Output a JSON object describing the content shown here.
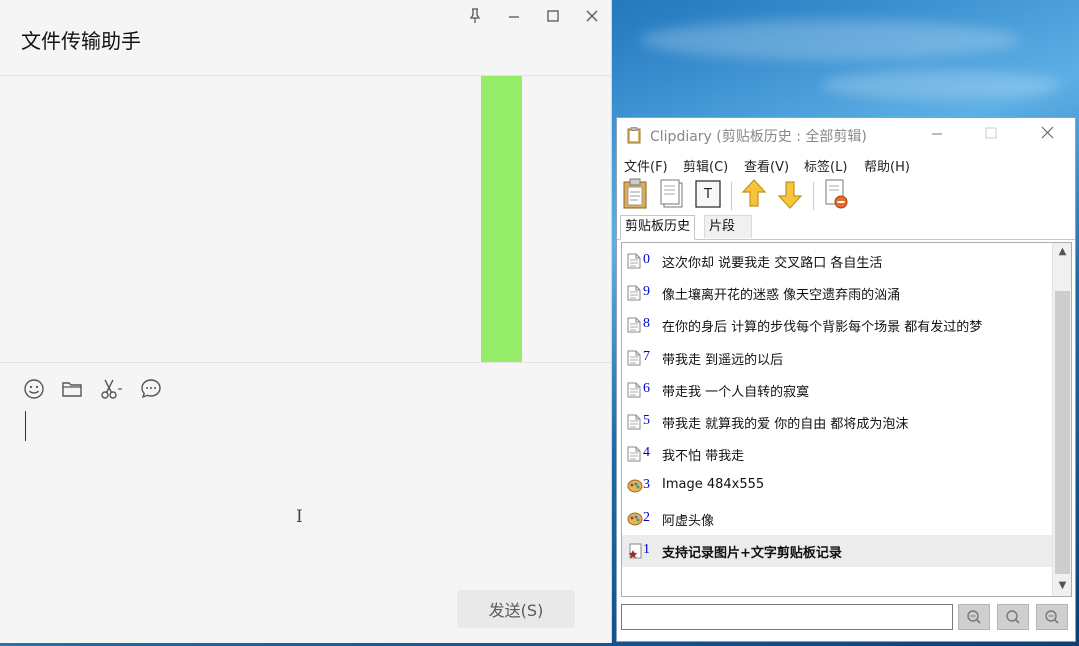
{
  "wechat": {
    "title": "文件传输助手",
    "send_label": "发送(S)",
    "window_controls": [
      "pin-icon",
      "minimize-icon",
      "maximize-icon",
      "close-icon"
    ],
    "toolbar_icons": [
      "emoji-icon",
      "folder-icon",
      "scissors-icon",
      "chat-history-icon"
    ],
    "bubble_color": "#95ec69"
  },
  "clipdiary": {
    "title": "Clipdiary (剪贴板历史 : 全部剪辑)",
    "menu": [
      "文件(F)",
      "剪辑(C)",
      "查看(V)",
      "标签(L)",
      "帮助(H)"
    ],
    "toolbar_icons": [
      "paste-icon",
      "copy-icon",
      "text-icon",
      "move-up-icon",
      "move-down-icon",
      "delete-icon"
    ],
    "tabs": [
      "剪贴板历史",
      "片段"
    ],
    "active_tab": "剪贴板历史",
    "items": [
      {
        "num": "0",
        "text": "这次你却 说要我走 交叉路口 各自生活",
        "type": "text"
      },
      {
        "num": "9",
        "text": "像土壤离开花的迷惑 像天空遗弃雨的汹涌",
        "type": "text"
      },
      {
        "num": "8",
        "text": "在你的身后 计算的步伐每个背影每个场景 都有发过的梦",
        "type": "text"
      },
      {
        "num": "7",
        "text": "带我走 到遥远的以后",
        "type": "text"
      },
      {
        "num": "6",
        "text": "带走我 一个人自转的寂寞",
        "type": "text"
      },
      {
        "num": "5",
        "text": "带我走 就算我的爱 你的自由 都将成为泡沫",
        "type": "text"
      },
      {
        "num": "4",
        "text": "我不怕 带我走",
        "type": "text"
      },
      {
        "num": "3",
        "text": "Image 484x555",
        "type": "image"
      },
      {
        "num": "2",
        "text": "阿虚头像",
        "type": "image"
      },
      {
        "num": "1",
        "text": "支持记录图片+文字剪贴板记录",
        "type": "starred"
      }
    ],
    "selected_index": 9,
    "search_placeholder": "",
    "accent_color": "#0000cc"
  }
}
